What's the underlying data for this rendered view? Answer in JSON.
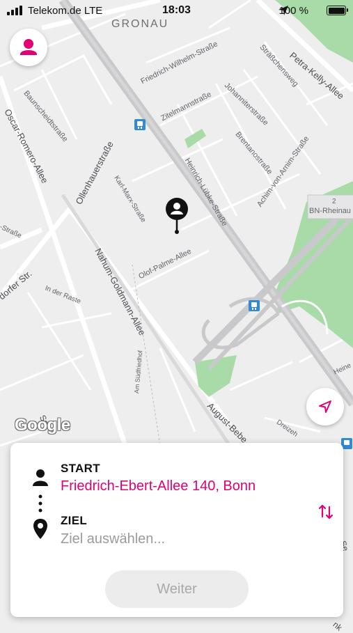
{
  "status_bar": {
    "carrier": "Telekom.de  LTE",
    "time": "18:03",
    "battery_pct": "100 %"
  },
  "map": {
    "district": "GRONAU",
    "streets": [
      "Friedrich-Wilhelm-Straße",
      "Sträßchensweg",
      "Petra-Kelly-Allee",
      "Baunscheidtstraße",
      "Johanniterstraße",
      "Zitelmannstraße",
      "Oscar-Romero-Allee",
      "Brentanostraße",
      "Ollenhauerstraße",
      "Karl-Marx-Straße",
      "Heinrich-Lübke-Straße",
      "Achim-von-Arnim-Straße",
      "Nahum-Goldmann-Allee",
      "Olof-Palme-Allee",
      "-Straße",
      "dorfer Str.",
      "In der Raste",
      "Am Südfriedhof",
      "August-Bebe",
      "Dreizeh",
      "Heine",
      "Se",
      "Se",
      "nk"
    ],
    "road_sign_number": "2",
    "road_sign_text": "BN-Rheinau",
    "google_logo": "Google"
  },
  "route_panel": {
    "start_label": "START",
    "start_value": "Friedrich-Ebert-Allee 140, Bonn",
    "ziel_label": "ZIEL",
    "ziel_placeholder": "Ziel auswählen...",
    "weiter_label": "Weiter"
  },
  "colors": {
    "accent": "#e20074",
    "park": "#a8dba8",
    "road": "#c9c9cc"
  }
}
